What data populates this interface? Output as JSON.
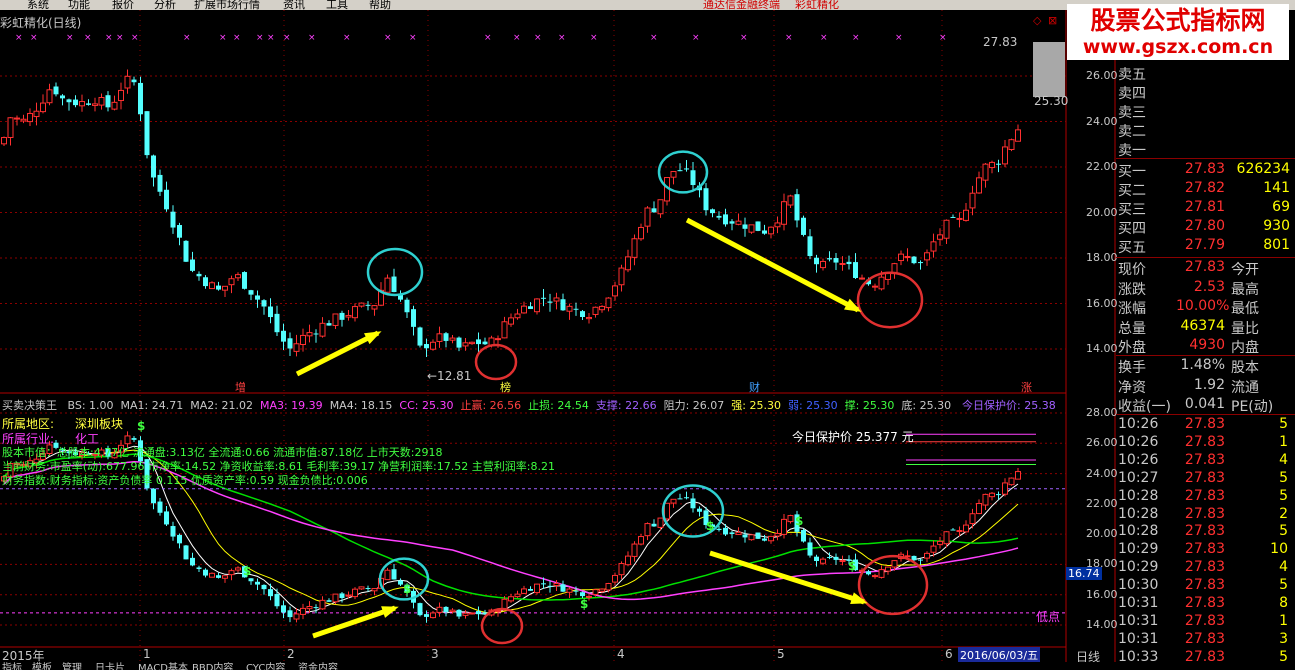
{
  "menu": [
    "系统",
    "功能",
    "报价",
    "分析",
    "扩展市场行情",
    "资讯",
    "工具",
    "帮助"
  ],
  "menu_center": [
    "通达信金融终端",
    "彩虹精化"
  ],
  "window_title": "彩虹精化(日线)",
  "watermark": {
    "line1": "股票公式指标网",
    "line2": "www.gszx.com.cn"
  },
  "upper": {
    "price_ticks": [
      "26.00",
      "24.00",
      "22.00",
      "20.00",
      "18.00",
      "16.00",
      "14.00"
    ],
    "high_label": "27.83",
    "right_label": "25.30",
    "low_label": "←12.81",
    "events": [
      "增",
      "榜",
      "财",
      "涨"
    ]
  },
  "lower": {
    "name": "买卖决策王",
    "params": [
      {
        "t": "BS: 1.00",
        "c": "#c8c8c8"
      },
      {
        "t": "MA1: 24.71",
        "c": "#c8c8c8"
      },
      {
        "t": "MA2: 21.02",
        "c": "#c8c8c8"
      },
      {
        "t": "MA3: 19.39",
        "c": "#ff40ff"
      },
      {
        "t": "MA4: 18.15",
        "c": "#c8c8c8"
      },
      {
        "t": "CC: 25.30",
        "c": "#ff40ff"
      },
      {
        "t": "止赢: 26.56",
        "c": "#ff4040"
      },
      {
        "t": "止损: 24.54",
        "c": "#40ff40"
      },
      {
        "t": "支撑: 22.66",
        "c": "#a060ff"
      },
      {
        "t": "阻力: 26.07",
        "c": "#c8c8c8"
      },
      {
        "t": "强: 25.30",
        "c": "#ffff40"
      },
      {
        "t": "弱: 25.30",
        "c": "#4060ff"
      },
      {
        "t": "撑: 25.30",
        "c": "#40ff40"
      },
      {
        "t": "底: 25.30",
        "c": "#c8c8c8"
      }
    ],
    "protect_label": "今日保护价: 25.38",
    "region_label": "所属地区:",
    "region_value": "深圳板块",
    "industry_label": "所属行业:",
    "industry_value": "化工",
    "fund_line1": "股本市值：总股本:4.77亿 流通盘:3.13亿 全流通:0.66 流通市值:87.18亿 上市天数:2918",
    "fund_line2": "当前财务:市盈率(动):677.96 市净率:14.52 净资收益率:8.61 毛利率:39.17 净营利润率:17.52 主营利润率:8.21",
    "fund_line3": "财务指数:财务指标:资产负债率 0.115 优质资产率:0.59 现金负债比:0.006",
    "protect_price_text": "今日保护价 25.377  元",
    "low_point": "低点",
    "level_label": "16.74",
    "price_ticks": [
      "28.00",
      "26.00",
      "24.00",
      "22.00",
      "20.00",
      "18.00",
      "16.00",
      "14.00"
    ],
    "top_cut": "28.00"
  },
  "dates": {
    "year": "2015年",
    "months": [
      "1",
      "2",
      "3",
      "4",
      "5",
      "6"
    ],
    "current": "2016/06/03/五",
    "period": "日线"
  },
  "quote": {
    "sell": [
      {
        "label": "卖五",
        "price": "",
        "vol": ""
      },
      {
        "label": "卖四",
        "price": "",
        "vol": ""
      },
      {
        "label": "卖三",
        "price": "",
        "vol": ""
      },
      {
        "label": "卖二",
        "price": "",
        "vol": ""
      },
      {
        "label": "卖一",
        "price": "",
        "vol": ""
      }
    ],
    "buy": [
      {
        "label": "买一",
        "price": "27.83",
        "vol": "626234"
      },
      {
        "label": "买二",
        "price": "27.82",
        "vol": "141"
      },
      {
        "label": "买三",
        "price": "27.81",
        "vol": "69"
      },
      {
        "label": "买四",
        "price": "27.80",
        "vol": "930"
      },
      {
        "label": "买五",
        "price": "27.79",
        "vol": "801"
      }
    ],
    "stats": [
      {
        "l1": "现价",
        "v1": "27.83",
        "l2": "今开",
        "c": "#ff3030"
      },
      {
        "l1": "涨跌",
        "v1": "2.53",
        "l2": "最高",
        "c": "#ff3030"
      },
      {
        "l1": "涨幅",
        "v1": "10.00%",
        "l2": "最低",
        "c": "#ff3030"
      },
      {
        "l1": "总量",
        "v1": "46374",
        "l2": "量比",
        "c": "#ffff00"
      },
      {
        "l1": "外盘",
        "v1": "4930",
        "l2": "内盘",
        "c": "#ff3030"
      }
    ],
    "stats2": [
      {
        "l1": "换手",
        "v1": "1.48%",
        "l2": "股本",
        "c": "#c8c8c8"
      },
      {
        "l1": "净资",
        "v1": "1.92",
        "l2": "流通",
        "c": "#c8c8c8"
      },
      {
        "l1": "收益(一)",
        "v1": "0.041",
        "l2": "PE(动)",
        "c": "#c8c8c8"
      }
    ],
    "ticks": [
      {
        "t": "10:26",
        "p": "27.83",
        "v": "5"
      },
      {
        "t": "10:26",
        "p": "27.83",
        "v": "1"
      },
      {
        "t": "10:26",
        "p": "27.83",
        "v": "4"
      },
      {
        "t": "10:27",
        "p": "27.83",
        "v": "5"
      },
      {
        "t": "10:28",
        "p": "27.83",
        "v": "5"
      },
      {
        "t": "10:28",
        "p": "27.83",
        "v": "2"
      },
      {
        "t": "10:28",
        "p": "27.83",
        "v": "5"
      },
      {
        "t": "10:29",
        "p": "27.83",
        "v": "10"
      },
      {
        "t": "10:29",
        "p": "27.83",
        "v": "4"
      },
      {
        "t": "10:30",
        "p": "27.83",
        "v": "5"
      },
      {
        "t": "10:31",
        "p": "27.83",
        "v": "8"
      },
      {
        "t": "10:31",
        "p": "27.83",
        "v": "1"
      },
      {
        "t": "10:31",
        "p": "27.83",
        "v": "3"
      },
      {
        "t": "10:33",
        "p": "27.83",
        "v": "5"
      }
    ]
  },
  "bottom_tabs": [
    "指标",
    "模板",
    "管理",
    "日卡片",
    "MACD基本",
    "BBD内容",
    "CYC内容",
    "资金内容"
  ],
  "colors": {
    "up": "#ff3030",
    "down": "#54ffff",
    "ma_white": "#ffffff",
    "ma_yellow": "#ffff00",
    "ma_green": "#00e000",
    "ma_magenta": "#ff40ff",
    "grid": "#8b0000"
  }
}
